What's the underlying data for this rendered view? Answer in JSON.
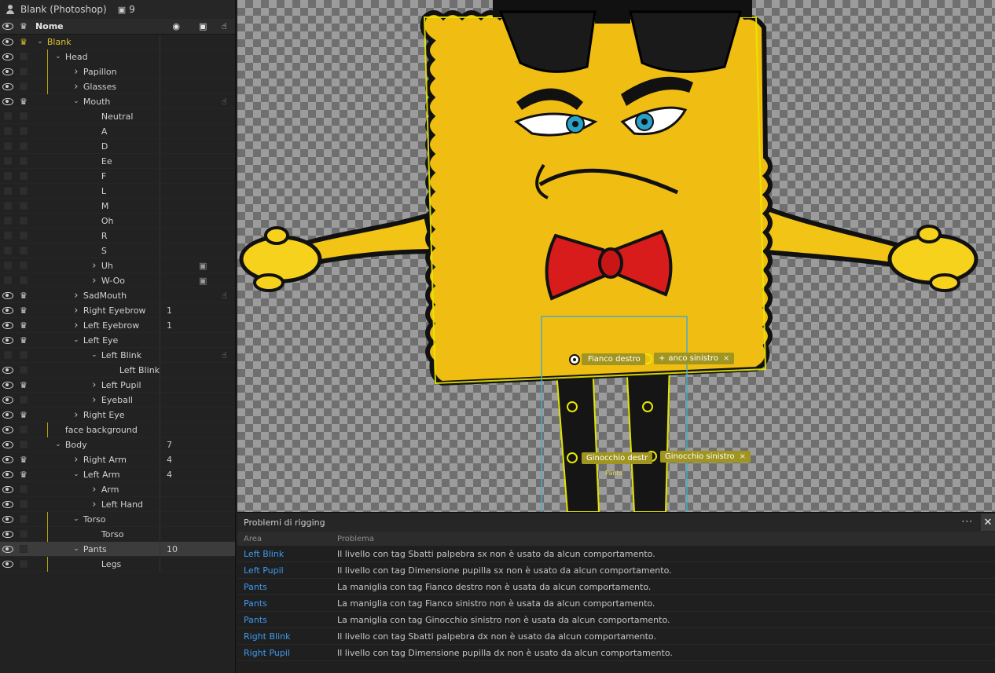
{
  "left_panel": {
    "title": "Blank (Photoshop)",
    "title_count": "9",
    "header_name": "Nome"
  },
  "layers": [
    {
      "name": "Blank",
      "indent": 0,
      "chevron": "down",
      "eye": true,
      "crown": "gold",
      "gold": true,
      "num": "",
      "extra": ""
    },
    {
      "name": "Head",
      "indent": 1,
      "chevron": "down",
      "eye": true,
      "crown": "",
      "gold": false,
      "num": "",
      "extra": "",
      "vline": true
    },
    {
      "name": "Papillon",
      "indent": 2,
      "chevron": "right",
      "eye": true,
      "crown": "",
      "num": "",
      "extra": "",
      "vline": true
    },
    {
      "name": "Glasses",
      "indent": 2,
      "chevron": "right",
      "eye": true,
      "crown": "",
      "num": "",
      "extra": "",
      "vline": true
    },
    {
      "name": "Mouth",
      "indent": 2,
      "chevron": "down",
      "eye": true,
      "crown": "white",
      "num": "",
      "extra": "hand"
    },
    {
      "name": "Neutral",
      "indent": 3,
      "chevron": "",
      "eye": false,
      "crown": "",
      "num": "",
      "extra": ""
    },
    {
      "name": "A",
      "indent": 3,
      "chevron": "",
      "eye": false,
      "crown": "",
      "num": "",
      "extra": ""
    },
    {
      "name": "D",
      "indent": 3,
      "chevron": "",
      "eye": false,
      "crown": "",
      "num": "",
      "extra": ""
    },
    {
      "name": "Ee",
      "indent": 3,
      "chevron": "",
      "eye": false,
      "crown": "",
      "num": "",
      "extra": ""
    },
    {
      "name": "F",
      "indent": 3,
      "chevron": "",
      "eye": false,
      "crown": "",
      "num": "",
      "extra": ""
    },
    {
      "name": "L",
      "indent": 3,
      "chevron": "",
      "eye": false,
      "crown": "",
      "num": "",
      "extra": ""
    },
    {
      "name": "M",
      "indent": 3,
      "chevron": "",
      "eye": false,
      "crown": "",
      "num": "",
      "extra": ""
    },
    {
      "name": "Oh",
      "indent": 3,
      "chevron": "",
      "eye": false,
      "crown": "",
      "num": "",
      "extra": ""
    },
    {
      "name": "R",
      "indent": 3,
      "chevron": "",
      "eye": false,
      "crown": "",
      "num": "",
      "extra": ""
    },
    {
      "name": "S",
      "indent": 3,
      "chevron": "",
      "eye": false,
      "crown": "",
      "num": "",
      "extra": ""
    },
    {
      "name": "Uh",
      "indent": 3,
      "chevron": "right",
      "eye": false,
      "crown": "",
      "num": "",
      "extra": "plus"
    },
    {
      "name": "W-Oo",
      "indent": 3,
      "chevron": "right",
      "eye": false,
      "crown": "",
      "num": "",
      "extra": "plus"
    },
    {
      "name": "SadMouth",
      "indent": 2,
      "chevron": "right",
      "eye": true,
      "crown": "white",
      "num": "",
      "extra": "hand"
    },
    {
      "name": "Right Eyebrow",
      "indent": 2,
      "chevron": "right",
      "eye": true,
      "crown": "white",
      "num": "1",
      "extra": ""
    },
    {
      "name": "Left Eyebrow",
      "indent": 2,
      "chevron": "right",
      "eye": true,
      "crown": "white",
      "num": "1",
      "extra": ""
    },
    {
      "name": "Left Eye",
      "indent": 2,
      "chevron": "down",
      "eye": true,
      "crown": "white",
      "num": "",
      "extra": ""
    },
    {
      "name": "Left Blink",
      "indent": 3,
      "chevron": "down",
      "eye": false,
      "crown": "",
      "num": "",
      "extra": "hand"
    },
    {
      "name": "Left Blink",
      "indent": 4,
      "chevron": "",
      "eye": true,
      "crown": "",
      "num": "",
      "extra": ""
    },
    {
      "name": "Left Pupil",
      "indent": 3,
      "chevron": "right",
      "eye": true,
      "crown": "white",
      "num": "",
      "extra": ""
    },
    {
      "name": "Eyeball",
      "indent": 3,
      "chevron": "right",
      "eye": true,
      "crown": "",
      "num": "",
      "extra": ""
    },
    {
      "name": "Right Eye",
      "indent": 2,
      "chevron": "right",
      "eye": true,
      "crown": "white",
      "num": "",
      "extra": ""
    },
    {
      "name": "face background",
      "indent": 1,
      "chevron": "",
      "eye": true,
      "crown": "",
      "num": "",
      "extra": "",
      "vline": true
    },
    {
      "name": "Body",
      "indent": 1,
      "chevron": "down",
      "eye": true,
      "crown": "",
      "num": "7",
      "extra": ""
    },
    {
      "name": "Right Arm",
      "indent": 2,
      "chevron": "right",
      "eye": true,
      "crown": "white",
      "num": "4",
      "extra": ""
    },
    {
      "name": "Left Arm",
      "indent": 2,
      "chevron": "down",
      "eye": true,
      "crown": "white",
      "num": "4",
      "extra": ""
    },
    {
      "name": "Arm",
      "indent": 3,
      "chevron": "right",
      "eye": true,
      "crown": "",
      "num": "",
      "extra": ""
    },
    {
      "name": "Left Hand",
      "indent": 3,
      "chevron": "right",
      "eye": true,
      "crown": "",
      "num": "",
      "extra": ""
    },
    {
      "name": "Torso",
      "indent": 2,
      "chevron": "down",
      "eye": true,
      "crown": "",
      "num": "",
      "extra": "",
      "vline": true
    },
    {
      "name": "Torso",
      "indent": 3,
      "chevron": "",
      "eye": true,
      "crown": "",
      "num": "",
      "extra": "",
      "vline": true
    },
    {
      "name": "Pants",
      "indent": 2,
      "chevron": "down",
      "eye": true,
      "crown": "",
      "num": "10",
      "extra": "",
      "selected": true
    },
    {
      "name": "Legs",
      "indent": 3,
      "chevron": "",
      "eye": true,
      "crown": "",
      "num": "",
      "extra": "",
      "vline": true
    }
  ],
  "canvas": {
    "tags": {
      "hip_right": "Fianco destro",
      "hip_left": "anco sinistro",
      "knee_right": "Ginocchio destr",
      "knee_left": "Ginocchio sinistro",
      "pants_label": "Pants"
    }
  },
  "issues_panel": {
    "title": "Problemi di rigging",
    "col_area": "Area",
    "col_problem": "Problema",
    "rows": [
      {
        "area": "Left Blink",
        "problem": "Il livello con tag Sbatti palpebra sx non è usato da alcun comportamento."
      },
      {
        "area": "Left Pupil",
        "problem": "Il livello con tag Dimensione pupilla sx non è usato da alcun comportamento."
      },
      {
        "area": "Pants",
        "problem": "La maniglia con tag Fianco destro non è usata da alcun comportamento."
      },
      {
        "area": "Pants",
        "problem": "La maniglia con tag Fianco sinistro non è usata da alcun comportamento."
      },
      {
        "area": "Pants",
        "problem": "La maniglia con tag Ginocchio sinistro non è usata da alcun comportamento."
      },
      {
        "area": "Right Blink",
        "problem": "Il livello con tag Sbatti palpebra dx non è usato da alcun comportamento."
      },
      {
        "area": "Right Pupil",
        "problem": "Il livello con tag Dimensione pupilla dx non è usato da alcun comportamento."
      }
    ]
  },
  "colors": {
    "accent_gold": "#d9c22e",
    "link_blue": "#3c9bf0",
    "tag_bg": "#a09520"
  }
}
